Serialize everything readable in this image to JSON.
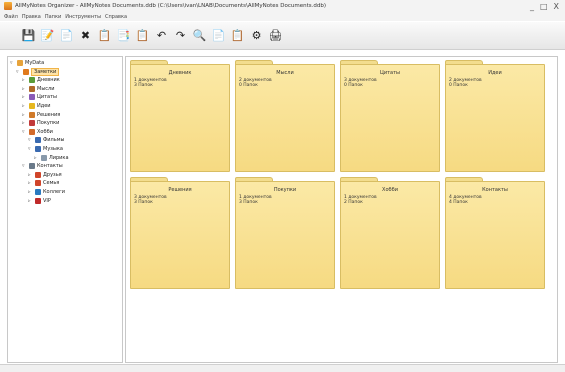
{
  "window": {
    "title": "AllMyNotes Organizer - AllMyNotes Documents.ddb (C:\\Users\\ivan\\LNAB\\Documents\\AllMyNotes Documents.ddb)",
    "controls": [
      "_",
      "□",
      "X"
    ]
  },
  "menu": [
    "Файл",
    "Правка",
    "Папки",
    "Инструменты",
    "Справка"
  ],
  "toolbar": [
    {
      "name": "save-icon",
      "glyph": "💾"
    },
    {
      "name": "new-note-icon",
      "glyph": "📝"
    },
    {
      "name": "new-folder-icon",
      "glyph": "📄"
    },
    {
      "name": "delete-icon",
      "glyph": "✖"
    },
    {
      "name": "cut-icon",
      "glyph": "📋"
    },
    {
      "name": "copy-icon",
      "glyph": "📑"
    },
    {
      "name": "paste-icon",
      "glyph": "📋"
    },
    {
      "name": "undo-icon",
      "glyph": "↶"
    },
    {
      "name": "redo-icon",
      "glyph": "↷"
    },
    {
      "name": "search-icon",
      "glyph": "🔍"
    },
    {
      "name": "format-icon",
      "glyph": "📄"
    },
    {
      "name": "clipboard-icon",
      "glyph": "📋"
    },
    {
      "name": "settings-icon",
      "glyph": "⚙"
    },
    {
      "name": "print-icon",
      "glyph": "🖨"
    }
  ],
  "tree": [
    {
      "label": "MyData",
      "indent": 0,
      "expanded": true,
      "color": "#e7a33b"
    },
    {
      "label": "Заметки",
      "indent": 1,
      "expanded": true,
      "color": "#e07a1d",
      "selected": true
    },
    {
      "label": "Дневник",
      "indent": 2,
      "expanded": false,
      "color": "#5a9c3a"
    },
    {
      "label": "Мысли",
      "indent": 2,
      "expanded": false,
      "color": "#b06a2a"
    },
    {
      "label": "Цитаты",
      "indent": 2,
      "expanded": false,
      "color": "#8a5bb8"
    },
    {
      "label": "Идеи",
      "indent": 2,
      "expanded": false,
      "color": "#e6b71e"
    },
    {
      "label": "Решения",
      "indent": 2,
      "expanded": false,
      "color": "#d07a2a"
    },
    {
      "label": "Покупки",
      "indent": 2,
      "expanded": false,
      "color": "#c23a3a"
    },
    {
      "label": "Хобби",
      "indent": 2,
      "expanded": true,
      "color": "#d26a2a"
    },
    {
      "label": "Фильмы",
      "indent": 3,
      "expanded": true,
      "color": "#3a6ab0"
    },
    {
      "label": "Музыка",
      "indent": 3,
      "expanded": true,
      "color": "#3a6ab0"
    },
    {
      "label": "Лирика",
      "indent": 4,
      "expanded": false,
      "color": "#8899aa"
    },
    {
      "label": "Контакты",
      "indent": 2,
      "expanded": true,
      "color": "#6a7a8a"
    },
    {
      "label": "Друзья",
      "indent": 3,
      "expanded": false,
      "color": "#d0452a"
    },
    {
      "label": "Семья",
      "indent": 3,
      "expanded": false,
      "color": "#d0452a"
    },
    {
      "label": "Коллеги",
      "indent": 3,
      "expanded": false,
      "color": "#2a7ac0"
    },
    {
      "label": "VIP",
      "indent": 3,
      "expanded": false,
      "color": "#c02a2a"
    }
  ],
  "folders": [
    {
      "title": "Дневник",
      "docs": "1 документов",
      "dirs": "3 Папок"
    },
    {
      "title": "Мысли",
      "docs": "2 документов",
      "dirs": "0 Папок"
    },
    {
      "title": "Цитаты",
      "docs": "3 документов",
      "dirs": "0 Папок"
    },
    {
      "title": "Идеи",
      "docs": "2 документов",
      "dirs": "0 Папок"
    },
    {
      "title": "Решения",
      "docs": "3 документов",
      "dirs": "3 Папок"
    },
    {
      "title": "Покупки",
      "docs": "1 документов",
      "dirs": "3 Папок"
    },
    {
      "title": "Хобби",
      "docs": "1 документов",
      "dirs": "2 Папок"
    },
    {
      "title": "Контакты",
      "docs": "4 документов",
      "dirs": "4 Папок"
    }
  ]
}
